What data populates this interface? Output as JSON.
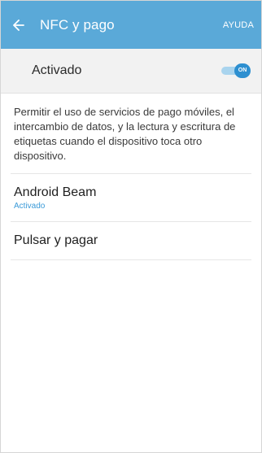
{
  "app_bar": {
    "title": "NFC y pago",
    "help_label": "AYUDA",
    "color": "#5aa9d8",
    "back_icon": "arrow-left-icon"
  },
  "master_switch": {
    "label": "Activado",
    "toggle_text": "ON",
    "state": true,
    "accent": "#2d8fd0"
  },
  "description": "Permitir el uso de servicios de pago móviles, el intercambio de datos, y la lectura y escritura de etiquetas cuando el dispositivo toca otro dispositivo.",
  "items": [
    {
      "title": "Android Beam",
      "subtitle": "Activado"
    },
    {
      "title": "Pulsar y pagar"
    }
  ]
}
